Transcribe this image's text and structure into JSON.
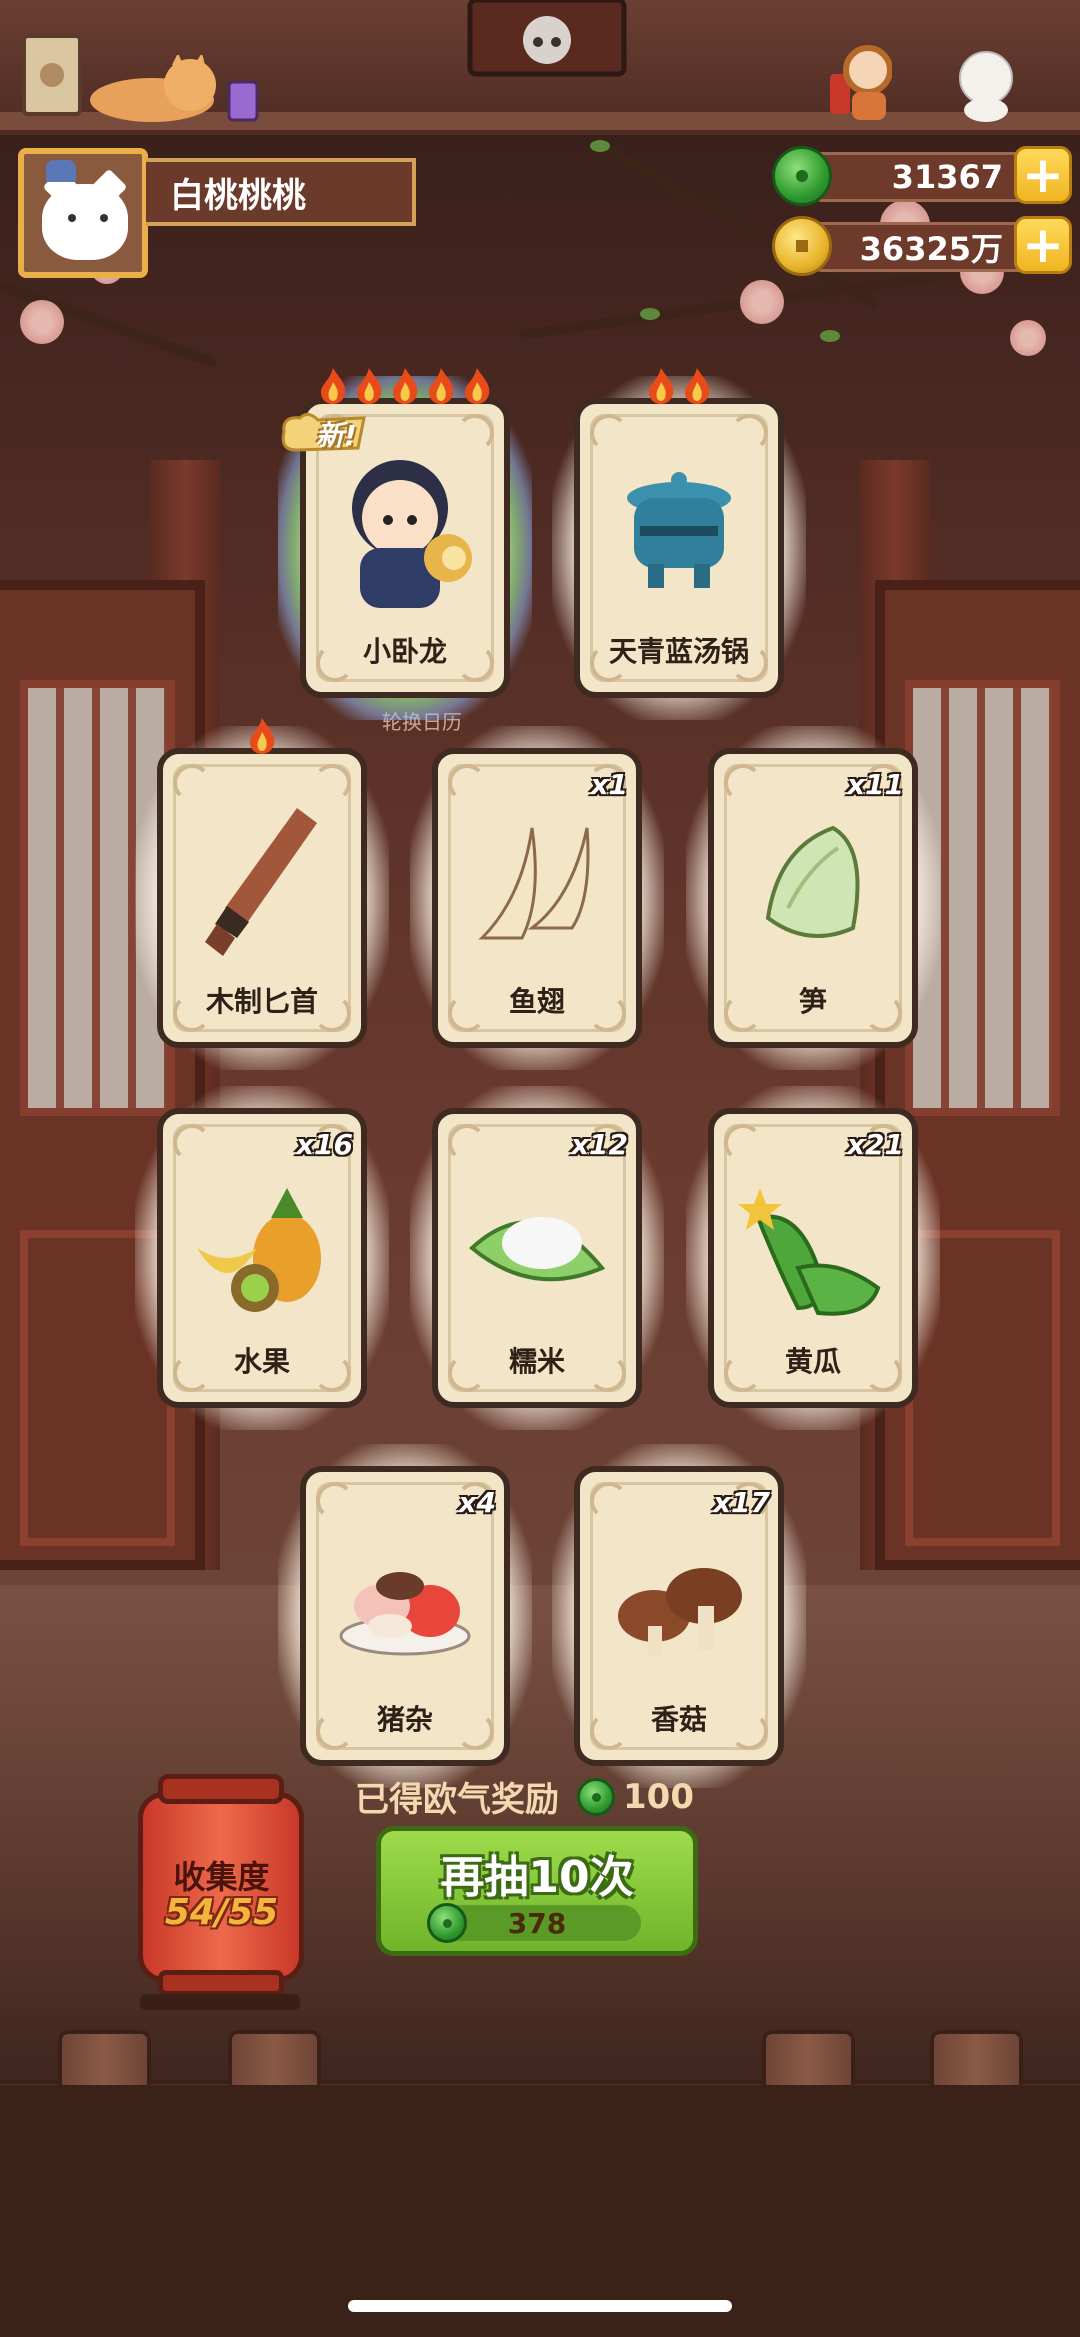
{
  "profile": {
    "name": "白桃桃桃"
  },
  "currency": {
    "jade": "31367",
    "gold": "36325万"
  },
  "calendar_label": "轮换日历",
  "new_badge": "新!",
  "cards": [
    {
      "name": "小卧龙",
      "count": "",
      "flames": 5,
      "is_new": true,
      "rainbow": true,
      "icon": "character-xiaowolong-icon"
    },
    {
      "name": "天青蓝汤锅",
      "count": "",
      "flames": 2,
      "is_new": false,
      "icon": "blue-pot-icon"
    },
    {
      "name": "木制匕首",
      "count": "",
      "flames": 1,
      "is_new": false,
      "icon": "wooden-dagger-icon"
    },
    {
      "name": "鱼翅",
      "count": "x1",
      "flames": 0,
      "icon": "shark-fin-icon"
    },
    {
      "name": "笋",
      "count": "x11",
      "flames": 0,
      "icon": "bamboo-shoot-icon"
    },
    {
      "name": "水果",
      "count": "x16",
      "flames": 0,
      "icon": "fruit-icon"
    },
    {
      "name": "糯米",
      "count": "x12",
      "flames": 0,
      "icon": "sticky-rice-icon"
    },
    {
      "name": "黄瓜",
      "count": "x21",
      "flames": 0,
      "icon": "cucumber-icon"
    },
    {
      "name": "猪杂",
      "count": "x4",
      "flames": 0,
      "icon": "pork-offal-icon"
    },
    {
      "name": "香菇",
      "count": "x17",
      "flames": 0,
      "icon": "shiitake-icon"
    }
  ],
  "reward": {
    "label": "已得欧气奖励",
    "value": "100"
  },
  "collection": {
    "label": "收集度",
    "value": "54/55"
  },
  "draw_button": {
    "label": "再抽10次",
    "cost": "378"
  },
  "colors": {
    "accent_green": "#6fb52a",
    "gold": "#f0b523",
    "card_bg": "#f3e6c8"
  }
}
